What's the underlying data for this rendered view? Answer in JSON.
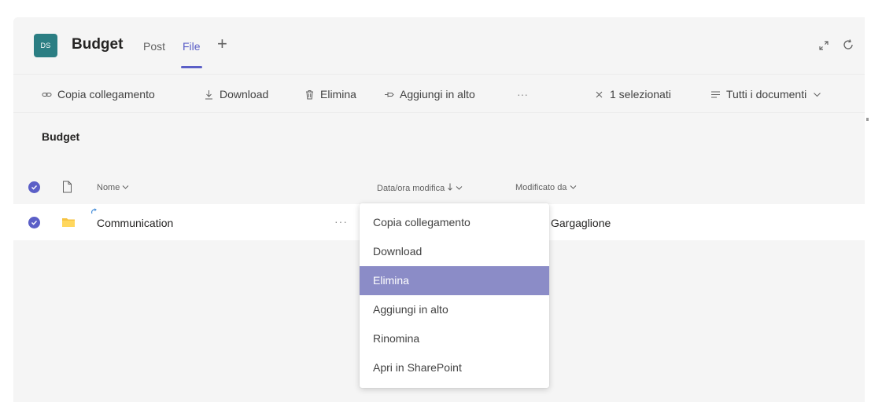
{
  "header": {
    "avatar_initials": "DS",
    "channel_title": "Budget",
    "tabs": [
      {
        "label": "Post",
        "active": false
      },
      {
        "label": "File",
        "active": true
      }
    ],
    "add_tab_symbol": "+",
    "icons": [
      "expand-icon",
      "refresh-icon"
    ]
  },
  "toolbar": {
    "copy_link": "Copia collegamento",
    "download": "Download",
    "delete": "Elimina",
    "pin_top": "Aggiungi in alto",
    "more": "···",
    "selected_count": "1 selezionati",
    "view": "Tutti i documenti"
  },
  "breadcrumb": "Budget",
  "table": {
    "columns": [
      {
        "label": "Nome",
        "sort_icon": "chevron-down-icon"
      },
      {
        "label": "Data/ora modifica",
        "sort_icon": "arrow-down-icon"
      },
      {
        "label": "Modificato da",
        "sort_icon": "chevron-down-icon"
      }
    ],
    "rows": [
      {
        "name": "Communication",
        "type": "folder",
        "selected": true,
        "modified_by": "Gargaglione",
        "more": "···"
      }
    ]
  },
  "context_menu": {
    "items": [
      {
        "label": "Copia collegamento",
        "highlighted": false
      },
      {
        "label": "Download",
        "highlighted": false
      },
      {
        "label": "Elimina",
        "highlighted": true
      },
      {
        "label": "Aggiungi in alto",
        "highlighted": false
      },
      {
        "label": "Rinomina",
        "highlighted": false
      },
      {
        "label": "Apri in SharePoint",
        "highlighted": false
      }
    ]
  },
  "colors": {
    "accent": "#5b5fc7",
    "avatar_bg": "#2b7e83",
    "menu_highlight": "#8b8cc7",
    "folder": "#f6c342"
  }
}
